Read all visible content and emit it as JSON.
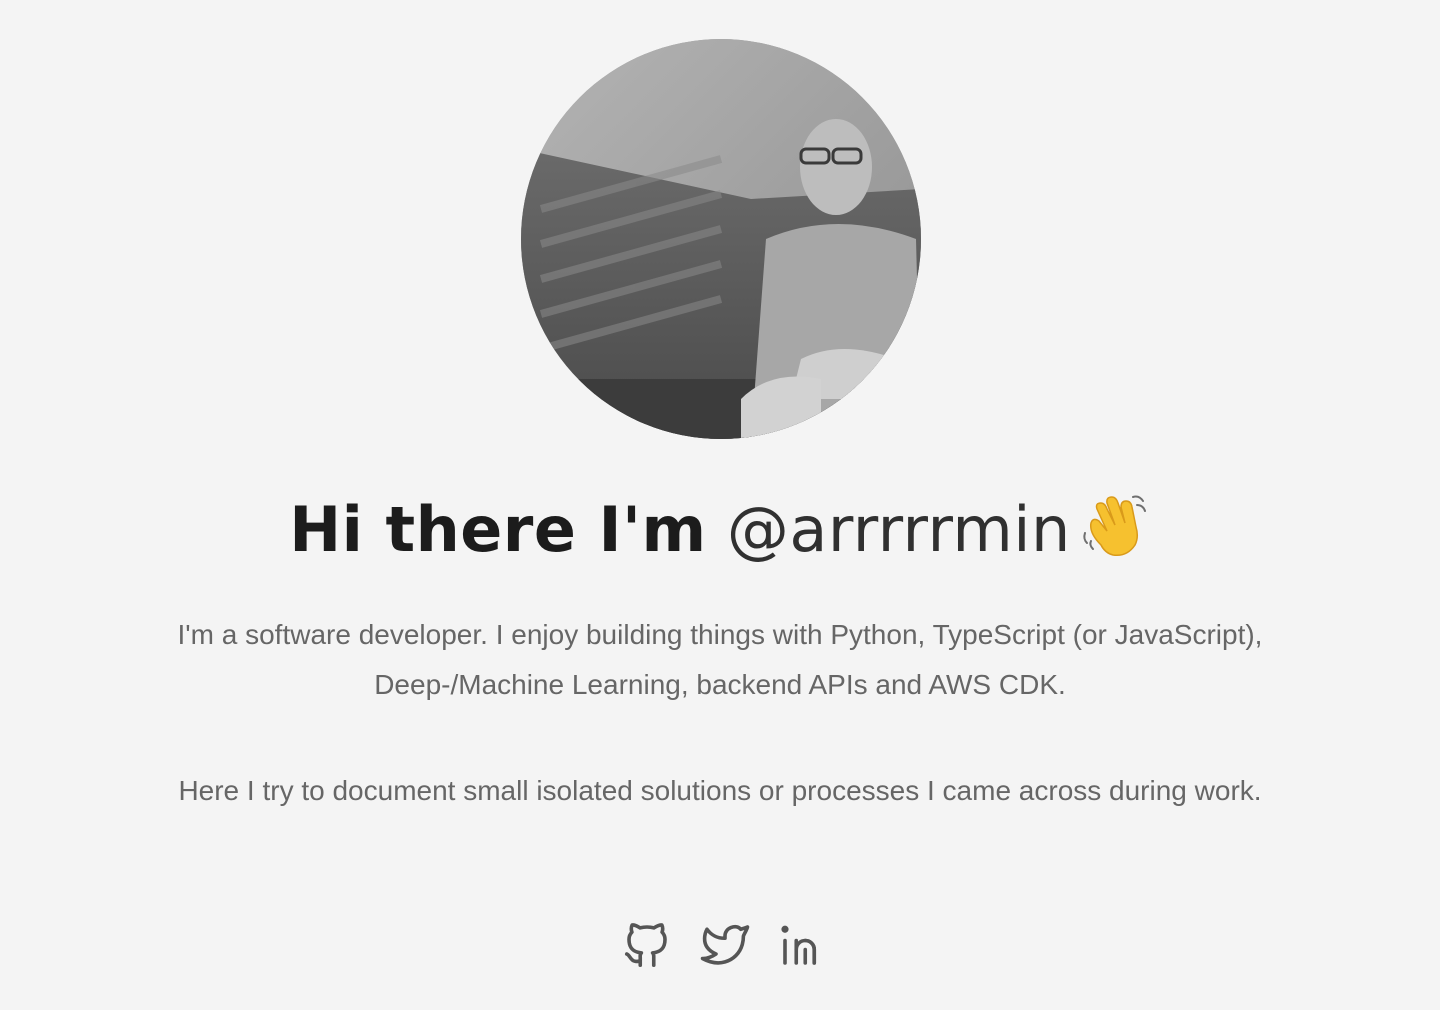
{
  "profile": {
    "avatar_alt": "Profile photo",
    "greeting_prefix": "Hi there I'm",
    "handle": "@arrrrrmin",
    "greeting_emoji": "👋"
  },
  "intro": {
    "paragraph_1": "I'm a software developer. I enjoy building things with Python, TypeScript (or JavaScript), Deep-/Machine Learning, backend APIs and AWS CDK.",
    "paragraph_2": "Here I try to document small isolated solutions or processes I came across during work."
  },
  "social_links": [
    {
      "name": "github",
      "icon": "github-icon"
    },
    {
      "name": "twitter",
      "icon": "twitter-icon"
    },
    {
      "name": "linkedin",
      "icon": "linkedin-icon"
    }
  ],
  "colors": {
    "background": "#f4f4f4",
    "heading": "#1c1c1c",
    "body_text": "#666666",
    "icon": "#555555"
  }
}
